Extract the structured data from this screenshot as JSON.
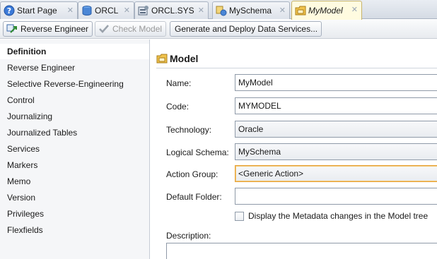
{
  "tabs": [
    {
      "label": "Start Page",
      "icon": "help-icon"
    },
    {
      "label": "ORCL",
      "icon": "database-icon"
    },
    {
      "label": "ORCL.SYS",
      "icon": "schema-icon"
    },
    {
      "label": "MySchema",
      "icon": "logical-schema-icon"
    },
    {
      "label": "MyModel",
      "icon": "model-icon",
      "active": true
    }
  ],
  "toolbar": {
    "reverse_engineer": "Reverse Engineer",
    "check_model": "Check Model",
    "generate_deploy": "Generate and Deploy Data Services..."
  },
  "nav": {
    "items": [
      {
        "label": "Definition",
        "selected": true
      },
      {
        "label": "Reverse Engineer"
      },
      {
        "label": "Selective Reverse-Engineering"
      },
      {
        "label": "Control"
      },
      {
        "label": "Journalizing"
      },
      {
        "label": "Journalized Tables"
      },
      {
        "label": "Services"
      },
      {
        "label": "Markers"
      },
      {
        "label": "Memo"
      },
      {
        "label": "Version"
      },
      {
        "label": "Privileges"
      },
      {
        "label": "Flexfields"
      }
    ]
  },
  "form": {
    "title": "Model",
    "name_label": "Name:",
    "name_value": "MyModel",
    "code_label": "Code:",
    "code_value": "MYMODEL",
    "technology_label": "Technology:",
    "technology_value": "Oracle",
    "logical_schema_label": "Logical Schema:",
    "logical_schema_value": "MySchema",
    "action_group_label": "Action Group:",
    "action_group_value": "<Generic Action>",
    "default_folder_label": "Default Folder:",
    "default_folder_value": "",
    "display_metadata_label": "Display the Metadata changes in the Model tree",
    "display_metadata_checked": false,
    "description_label": "Description:",
    "description_value": ""
  },
  "colors": {
    "active_tab": "#fffbe0",
    "focus_border": "#e6a33b",
    "nav_background": "#f5f6f8"
  }
}
